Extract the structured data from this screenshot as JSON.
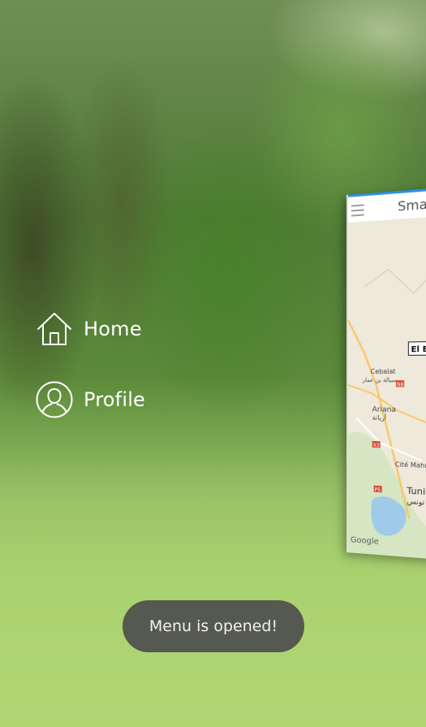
{
  "menu": {
    "items": [
      {
        "label": "Home",
        "icon": "home-icon"
      },
      {
        "label": "Profile",
        "icon": "profile-icon"
      }
    ]
  },
  "preview": {
    "app_title": "Smart",
    "map": {
      "places": {
        "el_bo": "El Bo",
        "cebalat": "Cebalat",
        "cebalat_ar": "سبالة بن عمار",
        "ariana": "Ariana",
        "ariana_ar": "أريانة",
        "cite_mahraj": "Cité Mahraje",
        "tunis": "Tunis",
        "tunis_ar": "تونس"
      },
      "road_badges": [
        "N8",
        "X3",
        "P5"
      ],
      "attribution": "Google",
      "accent": "#e05a3a"
    }
  },
  "toast": {
    "text": "Menu is opened!"
  },
  "colors": {
    "accent": "#2f8fe8",
    "toast_bg": "#50524e"
  }
}
